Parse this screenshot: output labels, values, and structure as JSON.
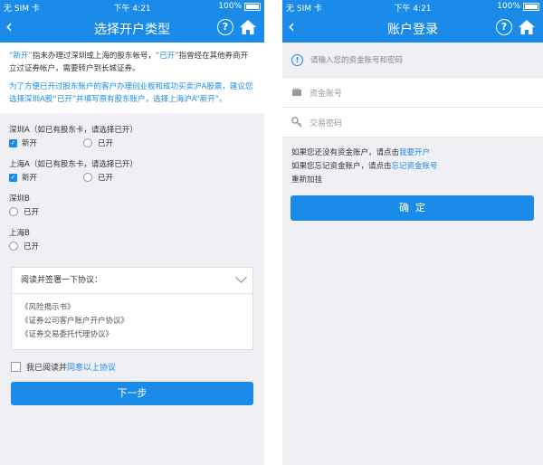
{
  "status": {
    "carrier": "无 SIM 卡",
    "time": "下午 4:21",
    "battery": "100%"
  },
  "left": {
    "nav_title": "选择开户类型",
    "back_icon": "chevron-left-icon",
    "help_symbol": "?",
    "info": {
      "q_open": "“新开”",
      "p1_a": "指未办理过深圳或上海的股东帐号，",
      "q_existing": "“已开”",
      "p1_b": "指曾经在其他券商开立过证券帐户，需要转户到长城证券。",
      "p2": "为了方便已开过股东账户的客户办理创业板和成功买卖沪A股票，建议您选择深圳A股“已开”并填写原有股东账户，选择上海沪A“新开”。"
    },
    "sections": [
      {
        "title": "深圳A（如已有股东卡，请选择已开）",
        "options": [
          "新开",
          "已开"
        ],
        "selected": "新开"
      },
      {
        "title": "上海A（如已有股东卡，请选择已开）",
        "options": [
          "新开",
          "已开"
        ],
        "selected": "新开"
      },
      {
        "title": "深圳B",
        "options": [
          "已开"
        ],
        "selected": ""
      },
      {
        "title": "上海B",
        "options": [
          "已开"
        ],
        "selected": ""
      }
    ],
    "agreement": {
      "header": "阅读并签署一下协议：",
      "items": [
        "《风险揭示书》",
        "《证券公司客户账户开户协议》",
        "《证券交易委托代理协议》"
      ]
    },
    "read_text": "我已阅读并",
    "read_link": "同意以上协议",
    "next_button": "下一步"
  },
  "right": {
    "nav_title": "账户登录",
    "help_symbol": "?",
    "hint": "请输入您的资金账号和密码",
    "hint_symbol": "!",
    "account_placeholder": "资金账号",
    "password_placeholder": "交易密码",
    "line1_text": "如果您还没有资金账户，请点击",
    "line1_link": "我要开户",
    "line2_text": "如果您忘记资金账户，请点击",
    "line2_link": "忘记资金账号",
    "relock": "重新加挂",
    "confirm_button": "确  定"
  },
  "colors": {
    "accent": "#1a8be8",
    "background": "#efeff4"
  }
}
